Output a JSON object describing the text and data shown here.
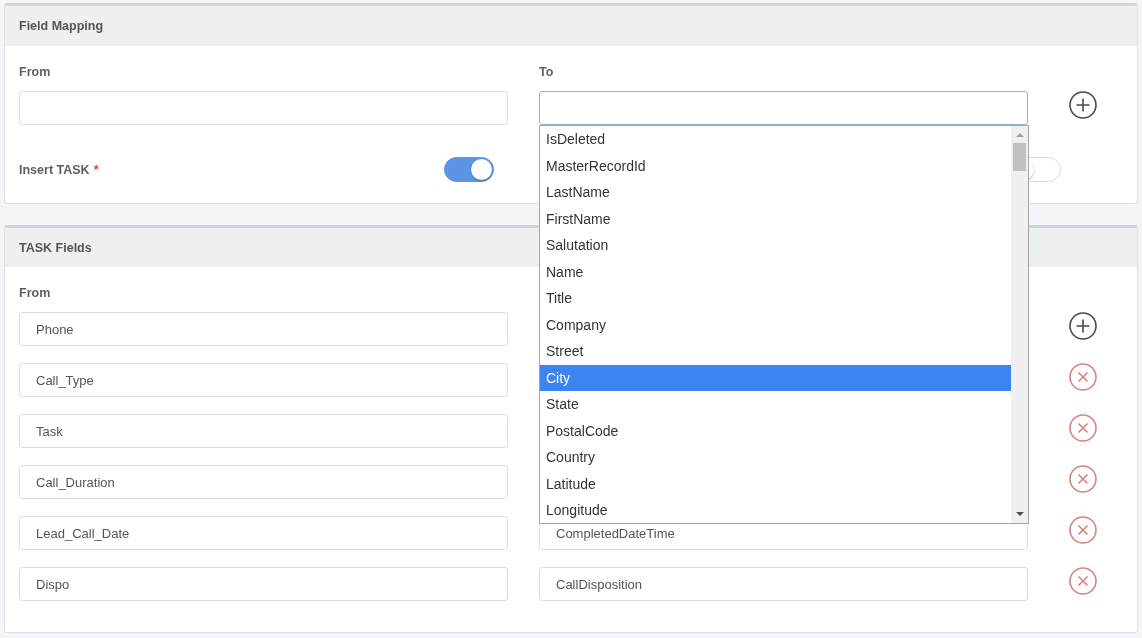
{
  "field_mapping": {
    "title": "Field Mapping",
    "from_label": "From",
    "to_label": "To",
    "from_field": {
      "focused": false
    },
    "to_field": {
      "focused": true
    },
    "kind": "add",
    "toggles": [
      {
        "label": "Insert TASK",
        "required_mark": "*",
        "on": true
      },
      {
        "on": false
      }
    ]
  },
  "task_fields": {
    "title": "TASK Fields",
    "from_label": "From",
    "rows": [
      {
        "from": "Phone",
        "kind": "add"
      },
      {
        "from": "Call_Type",
        "kind": "remove"
      },
      {
        "from": "Task",
        "kind": "remove"
      },
      {
        "from": "Call_Duration",
        "kind": "remove"
      },
      {
        "from": "Lead_Call_Date",
        "to": "CompletedDateTime",
        "kind": "remove"
      },
      {
        "from": "Dispo",
        "to": "CallDisposition",
        "kind": "remove"
      }
    ]
  },
  "dropdown": {
    "options": [
      {
        "label": "IsDeleted",
        "selected": false
      },
      {
        "label": "MasterRecordId",
        "selected": false
      },
      {
        "label": "LastName",
        "selected": false
      },
      {
        "label": "FirstName",
        "selected": false
      },
      {
        "label": "Salutation",
        "selected": false
      },
      {
        "label": "Name",
        "selected": false
      },
      {
        "label": "Title",
        "selected": false
      },
      {
        "label": "Company",
        "selected": false
      },
      {
        "label": "Street",
        "selected": false
      },
      {
        "label": "City",
        "selected": true
      },
      {
        "label": "State",
        "selected": false
      },
      {
        "label": "PostalCode",
        "selected": false
      },
      {
        "label": "Country",
        "selected": false
      },
      {
        "label": "Latitude",
        "selected": false
      },
      {
        "label": "Longitude",
        "selected": false
      }
    ]
  }
}
